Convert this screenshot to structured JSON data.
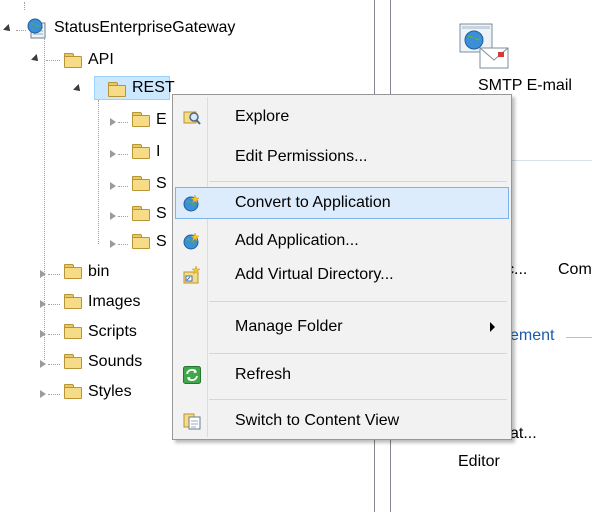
{
  "tree": {
    "root": "StatusEnterpriseGateway",
    "api": "API",
    "rest": "REST",
    "rest_children": [
      "E",
      "I",
      "S",
      "S",
      "S"
    ],
    "folders": [
      "bin",
      "Images",
      "Scripts",
      "Sounds",
      "Styles"
    ]
  },
  "context_menu": {
    "items": [
      {
        "label": "Explore",
        "icon": "explore-icon"
      },
      {
        "label": "Edit Permissions...",
        "icon": ""
      },
      {
        "label": "Convert to Application",
        "icon": "convert-app-globe-icon"
      },
      {
        "label": "Add Application...",
        "icon": "add-app-globe-icon"
      },
      {
        "label": "Add Virtual Directory...",
        "icon": "add-virtual-dir-icon"
      },
      {
        "label": "Manage Folder",
        "icon": ""
      },
      {
        "label": "Refresh",
        "icon": "refresh-icon"
      },
      {
        "label": "Switch to Content View",
        "icon": "content-view-icon"
      }
    ],
    "highlighted_index": 2
  },
  "right_pane": {
    "smtp_label": "SMTP E-mail",
    "partial_c": "c...",
    "partial_com": "Com",
    "section_label": "ement",
    "partial_at": "at...",
    "editor_label": "Editor"
  },
  "colors": {
    "selection_bg": "#cce8ff",
    "selection_border": "#99d1ff",
    "highlight_bg": "#dcecfc",
    "highlight_border": "#7eb4ea",
    "section_text": "#1e5aa8"
  }
}
